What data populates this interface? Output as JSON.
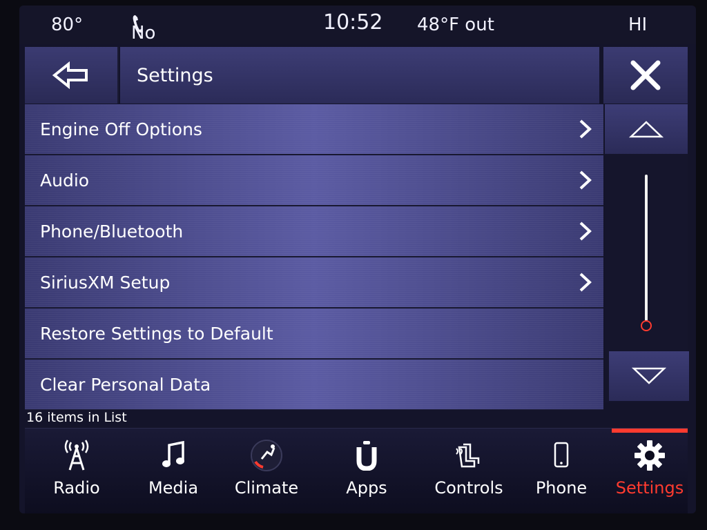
{
  "status": {
    "cabin_temp": "80°",
    "device": "No Device",
    "time": "10:52",
    "outside_temp": "48°F out",
    "fan": "HI"
  },
  "header": {
    "title": "Settings",
    "back_icon": "back-arrow-icon",
    "close_icon": "close-icon"
  },
  "list": {
    "items": [
      {
        "label": "Engine Off Options",
        "chevron": true
      },
      {
        "label": "Audio",
        "chevron": true
      },
      {
        "label": "Phone/Bluetooth",
        "chevron": true
      },
      {
        "label": "SiriusXM Setup",
        "chevron": true
      },
      {
        "label": "Restore Settings to Default",
        "chevron": false
      },
      {
        "label": "Clear Personal Data",
        "chevron": false
      }
    ],
    "count_text": "16 items in List"
  },
  "scrollbar": {
    "up_icon": "triangle-up-icon",
    "down_icon": "triangle-down-icon",
    "position_fraction": 1.0
  },
  "nav": {
    "items": [
      {
        "label": "Radio",
        "icon": "radio-tower-icon"
      },
      {
        "label": "Media",
        "icon": "music-note-icon"
      },
      {
        "label": "Climate",
        "icon": "climate-icon"
      },
      {
        "label": "Apps",
        "icon": "apps-icon"
      },
      {
        "label": "Controls",
        "icon": "controls-icon"
      },
      {
        "label": "Phone",
        "icon": "phone-icon"
      },
      {
        "label": "Settings",
        "icon": "gear-icon"
      }
    ],
    "active_index": 6
  },
  "colors": {
    "accent": "#ff3b2f",
    "background": "#14142a",
    "row": "#4a4a8c"
  }
}
